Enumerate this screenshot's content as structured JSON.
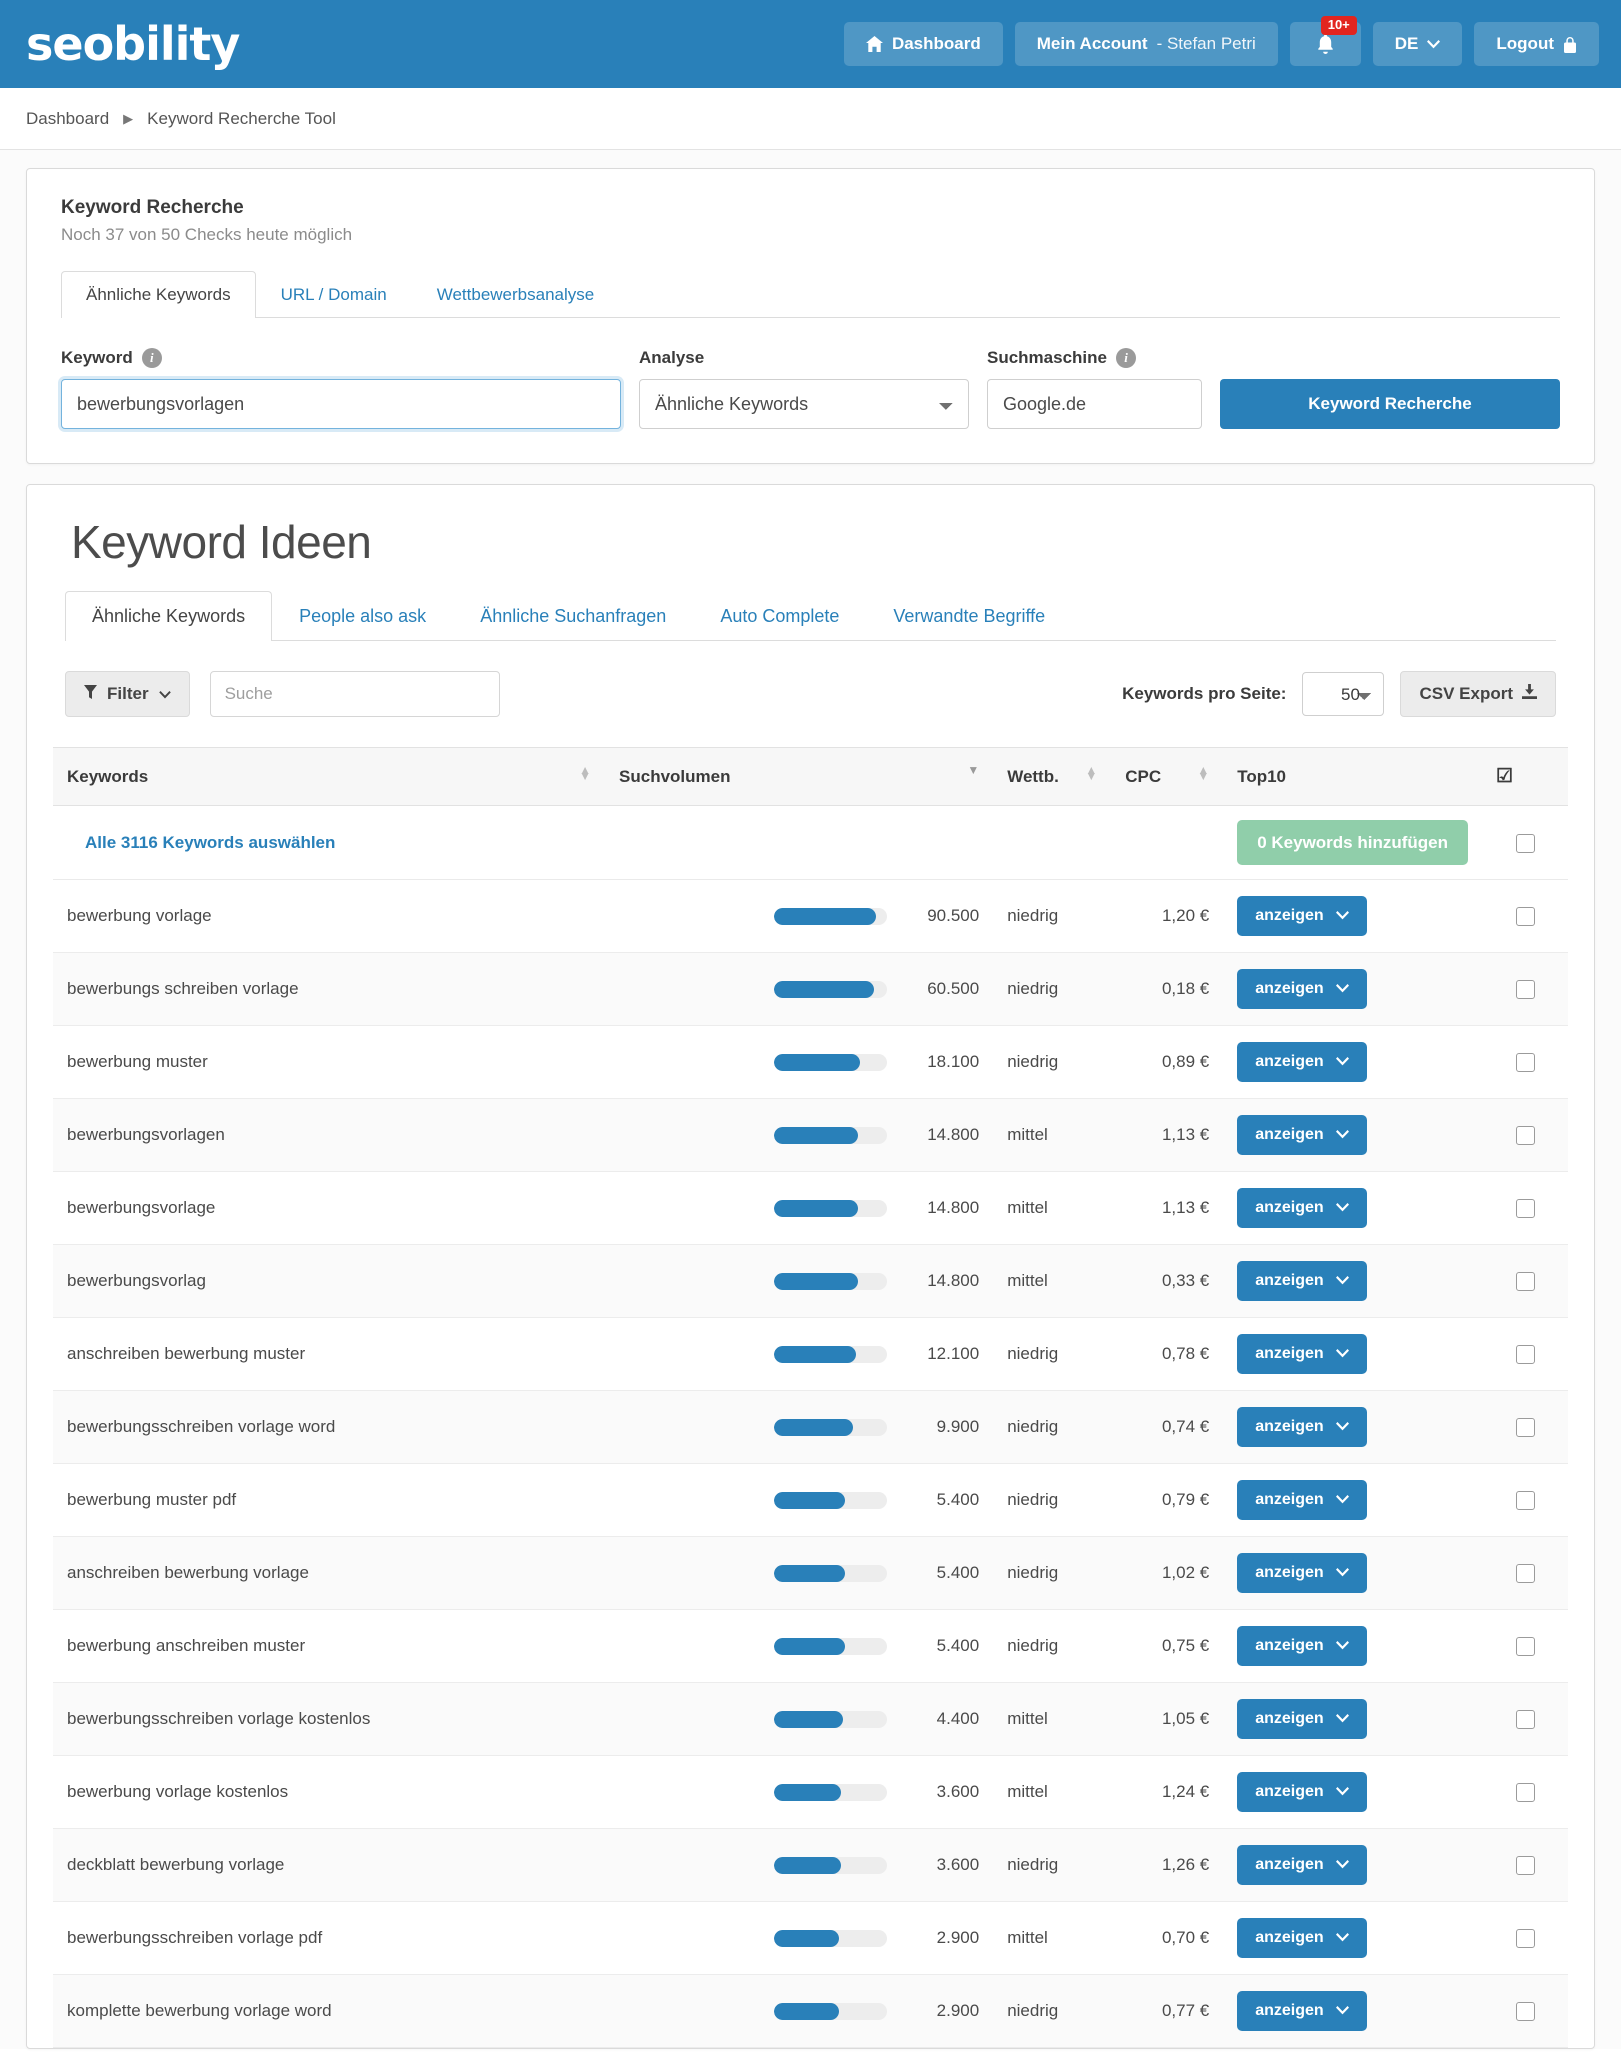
{
  "brand": {
    "logo_text": "seobility"
  },
  "header": {
    "dashboard_label": "Dashboard",
    "account_label_bold": "Mein Account",
    "account_label_light": "- Stefan Petri",
    "notifications_badge": "10+",
    "language_label": "DE",
    "logout_label": "Logout"
  },
  "breadcrumb": {
    "home": "Dashboard",
    "current": "Keyword Recherche Tool"
  },
  "search_panel": {
    "title": "Keyword Recherche",
    "subtitle": "Noch 37 von 50 Checks heute möglich",
    "tabs": [
      {
        "label": "Ähnliche Keywords",
        "active": true
      },
      {
        "label": "URL / Domain",
        "active": false
      },
      {
        "label": "Wettbewerbsanalyse",
        "active": false
      }
    ],
    "keyword_label": "Keyword",
    "keyword_value": "bewerbungsvorlagen",
    "analyse_label": "Analyse",
    "analyse_value": "Ähnliche Keywords",
    "engine_label": "Suchmaschine",
    "engine_value": "Google.de",
    "submit_label": "Keyword Recherche"
  },
  "results": {
    "title": "Keyword Ideen",
    "tabs": [
      {
        "label": "Ähnliche Keywords",
        "active": true
      },
      {
        "label": "People also ask",
        "active": false
      },
      {
        "label": "Ähnliche Suchanfragen",
        "active": false
      },
      {
        "label": "Auto Complete",
        "active": false
      },
      {
        "label": "Verwandte Begriffe",
        "active": false
      }
    ],
    "filter_label": "Filter",
    "search_placeholder": "Suche",
    "search_value": "",
    "per_page_label": "Keywords pro Seite:",
    "per_page_value": "50",
    "csv_label": "CSV Export",
    "select_all_label": "Alle 3116 Keywords auswählen",
    "add_keywords_label": "0 Keywords hinzufügen",
    "columns": {
      "keywords": "Keywords",
      "volume": "Suchvolumen",
      "competition": "Wettb.",
      "cpc": "CPC",
      "top10": "Top10"
    },
    "row_action_label": "anzeigen",
    "rows": [
      {
        "keyword": "bewerbung vorlage",
        "volume": "90.500",
        "bar_pct": 90,
        "competition": "niedrig",
        "cpc": "1,20 €"
      },
      {
        "keyword": "bewerbungs schreiben vorlage",
        "volume": "60.500",
        "bar_pct": 88,
        "competition": "niedrig",
        "cpc": "0,18 €"
      },
      {
        "keyword": "bewerbung muster",
        "volume": "18.100",
        "bar_pct": 76,
        "competition": "niedrig",
        "cpc": "0,89 €"
      },
      {
        "keyword": "bewerbungsvorlagen",
        "volume": "14.800",
        "bar_pct": 74,
        "competition": "mittel",
        "cpc": "1,13 €"
      },
      {
        "keyword": "bewerbungsvorlage",
        "volume": "14.800",
        "bar_pct": 74,
        "competition": "mittel",
        "cpc": "1,13 €"
      },
      {
        "keyword": "bewerbungsvorlag",
        "volume": "14.800",
        "bar_pct": 74,
        "competition": "mittel",
        "cpc": "0,33 €"
      },
      {
        "keyword": "anschreiben bewerbung muster",
        "volume": "12.100",
        "bar_pct": 72,
        "competition": "niedrig",
        "cpc": "0,78 €"
      },
      {
        "keyword": "bewerbungsschreiben vorlage word",
        "volume": "9.900",
        "bar_pct": 70,
        "competition": "niedrig",
        "cpc": "0,74 €"
      },
      {
        "keyword": "bewerbung muster pdf",
        "volume": "5.400",
        "bar_pct": 63,
        "competition": "niedrig",
        "cpc": "0,79 €"
      },
      {
        "keyword": "anschreiben bewerbung vorlage",
        "volume": "5.400",
        "bar_pct": 63,
        "competition": "niedrig",
        "cpc": "1,02 €"
      },
      {
        "keyword": "bewerbung anschreiben muster",
        "volume": "5.400",
        "bar_pct": 63,
        "competition": "niedrig",
        "cpc": "0,75 €"
      },
      {
        "keyword": "bewerbungsschreiben vorlage kostenlos",
        "volume": "4.400",
        "bar_pct": 61,
        "competition": "mittel",
        "cpc": "1,05 €"
      },
      {
        "keyword": "bewerbung vorlage kostenlos",
        "volume": "3.600",
        "bar_pct": 59,
        "competition": "mittel",
        "cpc": "1,24 €"
      },
      {
        "keyword": "deckblatt bewerbung vorlage",
        "volume": "3.600",
        "bar_pct": 59,
        "competition": "niedrig",
        "cpc": "1,26 €"
      },
      {
        "keyword": "bewerbungsschreiben vorlage pdf",
        "volume": "2.900",
        "bar_pct": 57,
        "competition": "mittel",
        "cpc": "0,70 €"
      },
      {
        "keyword": "komplette bewerbung vorlage word",
        "volume": "2.900",
        "bar_pct": 57,
        "competition": "niedrig",
        "cpc": "0,77 €"
      }
    ]
  },
  "colors": {
    "brand_blue": "#2980b9",
    "badge_red": "#e2251f",
    "green": "#90ceaa"
  }
}
